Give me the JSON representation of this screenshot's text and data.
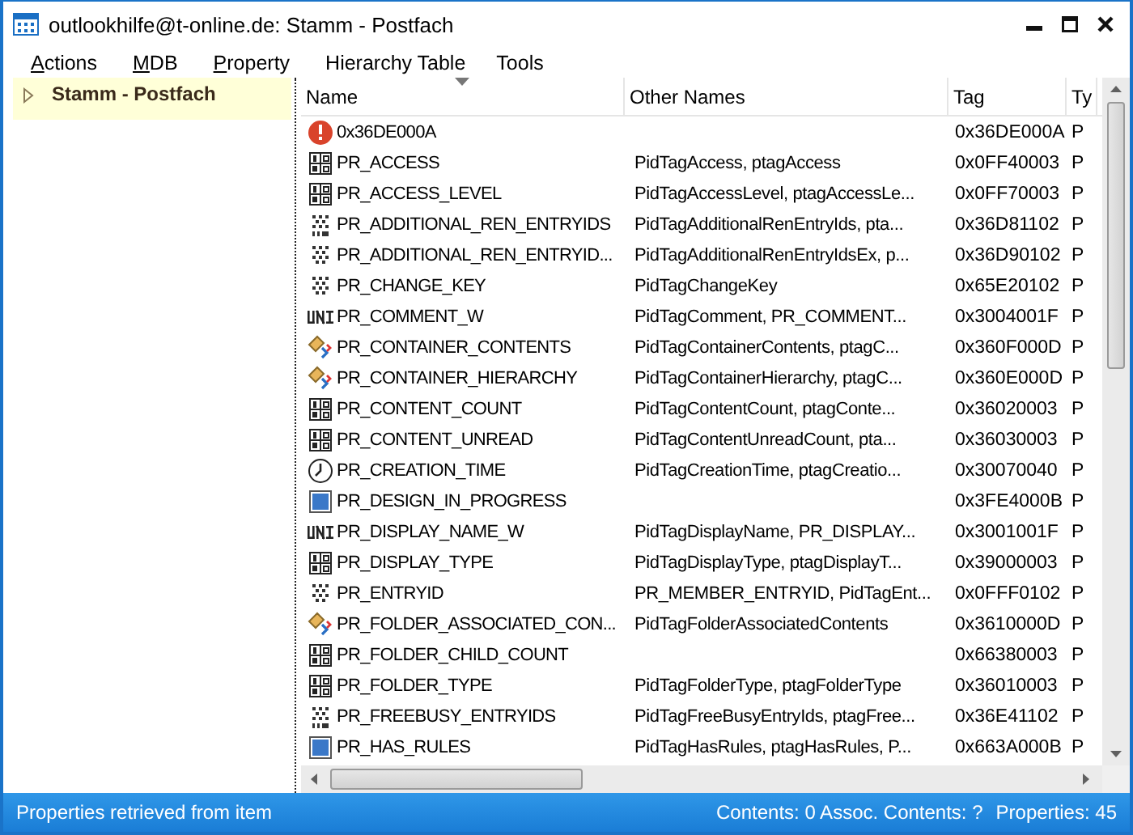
{
  "window": {
    "title": "outlookhilfe@t-online.de: Stamm - Postfach"
  },
  "menu": [
    {
      "label": "Actions",
      "mnemonic": true
    },
    {
      "label": "MDB",
      "mnemonic": true
    },
    {
      "label": "Property",
      "mnemonic": true
    },
    {
      "label": "Hierarchy Table",
      "mnemonic": false
    },
    {
      "label": "Tools",
      "mnemonic": false
    }
  ],
  "tree": [
    {
      "label": "Stamm - Postfach",
      "selected": true,
      "expanded": false
    }
  ],
  "table": {
    "columns": [
      "Name",
      "Other Names",
      "Tag",
      "Ty"
    ],
    "rows": [
      {
        "kind": "error",
        "name": "0x36DE000A",
        "other": "",
        "tag": "0x36DE000A",
        "type": "P"
      },
      {
        "kind": "number",
        "name": "PR_ACCESS",
        "other": "PidTagAccess, ptagAccess",
        "tag": "0x0FF40003",
        "type": "P"
      },
      {
        "kind": "number",
        "name": "PR_ACCESS_LEVEL",
        "other": "PidTagAccessLevel, ptagAccessLe...",
        "tag": "0x0FF70003",
        "type": "P"
      },
      {
        "kind": "binary_multi",
        "name": "PR_ADDITIONAL_REN_ENTRYIDS",
        "other": "PidTagAdditionalRenEntryIds, pta...",
        "tag": "0x36D81102",
        "type": "P"
      },
      {
        "kind": "binary",
        "name": "PR_ADDITIONAL_REN_ENTRYID...",
        "other": "PidTagAdditionalRenEntryIdsEx, p...",
        "tag": "0x36D90102",
        "type": "P"
      },
      {
        "kind": "binary",
        "name": "PR_CHANGE_KEY",
        "other": "PidTagChangeKey",
        "tag": "0x65E20102",
        "type": "P"
      },
      {
        "kind": "unicode",
        "name": "PR_COMMENT_W",
        "other": "PidTagComment, PR_COMMENT...",
        "tag": "0x3004001F",
        "type": "P"
      },
      {
        "kind": "object",
        "name": "PR_CONTAINER_CONTENTS",
        "other": "PidTagContainerContents, ptagC...",
        "tag": "0x360F000D",
        "type": "P"
      },
      {
        "kind": "object",
        "name": "PR_CONTAINER_HIERARCHY",
        "other": "PidTagContainerHierarchy, ptagC...",
        "tag": "0x360E000D",
        "type": "P"
      },
      {
        "kind": "number",
        "name": "PR_CONTENT_COUNT",
        "other": "PidTagContentCount, ptagConte...",
        "tag": "0x36020003",
        "type": "P"
      },
      {
        "kind": "number",
        "name": "PR_CONTENT_UNREAD",
        "other": "PidTagContentUnreadCount, pta...",
        "tag": "0x36030003",
        "type": "P"
      },
      {
        "kind": "time",
        "name": "PR_CREATION_TIME",
        "other": "PidTagCreationTime, ptagCreatio...",
        "tag": "0x30070040",
        "type": "P"
      },
      {
        "kind": "bool",
        "name": "PR_DESIGN_IN_PROGRESS",
        "other": "",
        "tag": "0x3FE4000B",
        "type": "P"
      },
      {
        "kind": "unicode",
        "name": "PR_DISPLAY_NAME_W",
        "other": "PidTagDisplayName, PR_DISPLAY...",
        "tag": "0x3001001F",
        "type": "P"
      },
      {
        "kind": "number",
        "name": "PR_DISPLAY_TYPE",
        "other": "PidTagDisplayType, ptagDisplayT...",
        "tag": "0x39000003",
        "type": "P"
      },
      {
        "kind": "binary",
        "name": "PR_ENTRYID",
        "other": "PR_MEMBER_ENTRYID, PidTagEnt...",
        "tag": "0x0FFF0102",
        "type": "P"
      },
      {
        "kind": "object",
        "name": "PR_FOLDER_ASSOCIATED_CON...",
        "other": "PidTagFolderAssociatedContents",
        "tag": "0x3610000D",
        "type": "P"
      },
      {
        "kind": "number",
        "name": "PR_FOLDER_CHILD_COUNT",
        "other": "",
        "tag": "0x66380003",
        "type": "P"
      },
      {
        "kind": "number",
        "name": "PR_FOLDER_TYPE",
        "other": "PidTagFolderType, ptagFolderType",
        "tag": "0x36010003",
        "type": "P"
      },
      {
        "kind": "binary_multi",
        "name": "PR_FREEBUSY_ENTRYIDS",
        "other": "PidTagFreeBusyEntryIds, ptagFree...",
        "tag": "0x36E41102",
        "type": "P"
      },
      {
        "kind": "bool",
        "name": "PR_HAS_RULES",
        "other": "PidTagHasRules, ptagHasRules, P...",
        "tag": "0x663A000B",
        "type": "P"
      }
    ]
  },
  "status_bar": {
    "message": "Properties retrieved from item",
    "contents": "Contents: 0 Assoc. Contents: ?",
    "properties": "Properties: 45"
  }
}
